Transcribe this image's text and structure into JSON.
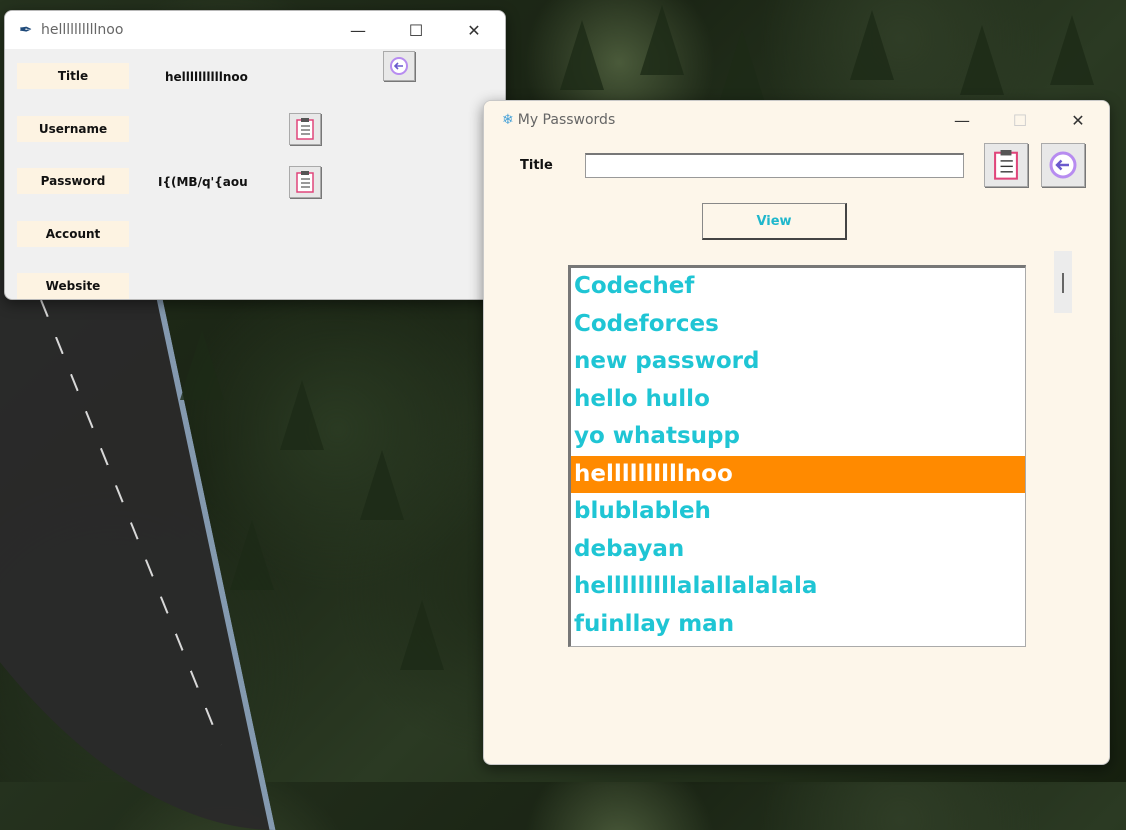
{
  "window1": {
    "title": "hellllllllllnoo",
    "fields": [
      {
        "label": "Title",
        "value": "hellllllllllnoo"
      },
      {
        "label": "Username",
        "value": ""
      },
      {
        "label": "Password",
        "value": "I{(MB/q'{aou"
      },
      {
        "label": "Account",
        "value": ""
      },
      {
        "label": "Website",
        "value": ""
      }
    ],
    "controls": {
      "minimize": "—",
      "maximize": "☐",
      "close": "✕"
    }
  },
  "window2": {
    "title": "My Passwords",
    "title_label": "Title",
    "title_input_value": "",
    "view_label": "View",
    "list": [
      "Codechef",
      "Codeforces",
      "new password",
      "hello hullo",
      "yo whatsupp",
      "hellllllllllnoo",
      "blublableh",
      "debayan",
      "helllllllllalallalalala",
      "fuinllay man"
    ],
    "selected_index": 5,
    "controls": {
      "minimize": "—",
      "maximize": "☐",
      "close": "✕"
    }
  },
  "colors": {
    "accent_text": "#1fc5d4",
    "selected_bg": "#ff8a00",
    "label_bg": "#fdf3e2",
    "window2_bg": "#fdf6ea"
  }
}
